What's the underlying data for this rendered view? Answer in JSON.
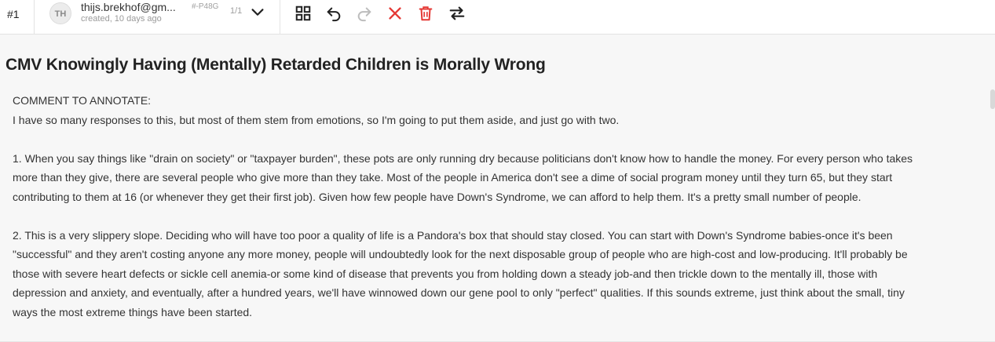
{
  "toolbar": {
    "task_id": "#1",
    "annotation": {
      "avatar_initials": "TH",
      "user_email": "thijs.brekhof@gm...",
      "created": "created, 10 days ago",
      "code": "#-P48G",
      "count": "1/1"
    },
    "tools": [
      {
        "name": "grid-view-icon",
        "color": "#222222"
      },
      {
        "name": "undo-icon",
        "color": "#222222"
      },
      {
        "name": "redo-icon",
        "color": "#bdbdbd"
      },
      {
        "name": "close-icon",
        "color": "#e53935"
      },
      {
        "name": "delete-icon",
        "color": "#e53935"
      },
      {
        "name": "swap-icon",
        "color": "#222222"
      }
    ]
  },
  "main": {
    "title": "CMV Knowingly Having (Mentally) Retarded Children is Morally Wrong",
    "comment_label": "COMMENT TO ANNOTATE:",
    "comment_lines": [
      "I have so many responses to this, but most of them stem from emotions, so I'm going to put them aside, and just go with two.",
      "",
      "1. When you say things like \"drain on society\" or \"taxpayer burden\", these pots are only running dry because politicians don't know how to handle the money. For every person who takes",
      "more than they give, there are several people who give more than they take. Most of the people in America don't see a dime of social program money until they turn 65, but they start",
      "contributing to them at 16 (or whenever they get their first job). Given how few people have Down's Syndrome, we can afford to help them. It's a pretty small number of people.",
      "",
      "2. This is a very slippery slope. Deciding who will have too poor a quality of life is a Pandora's box that should stay closed. You can start with Down's Syndrome babies-once it's been",
      "\"successful\" and they aren't costing anyone any more money, people will undoubtedly look for the next disposable group of people who are high-cost and low-producing. It'll probably be",
      "those with severe heart defects or sickle cell anemia-or some kind of disease that prevents you from holding down a steady job-and then trickle down to the mentally ill, those with",
      "depression and anxiety, and eventually, after a hundred years, we'll have winnowed down our gene pool to only \"perfect\" qualities. If this sounds extreme, just think about the small, tiny",
      "ways the most extreme things have been started."
    ]
  }
}
